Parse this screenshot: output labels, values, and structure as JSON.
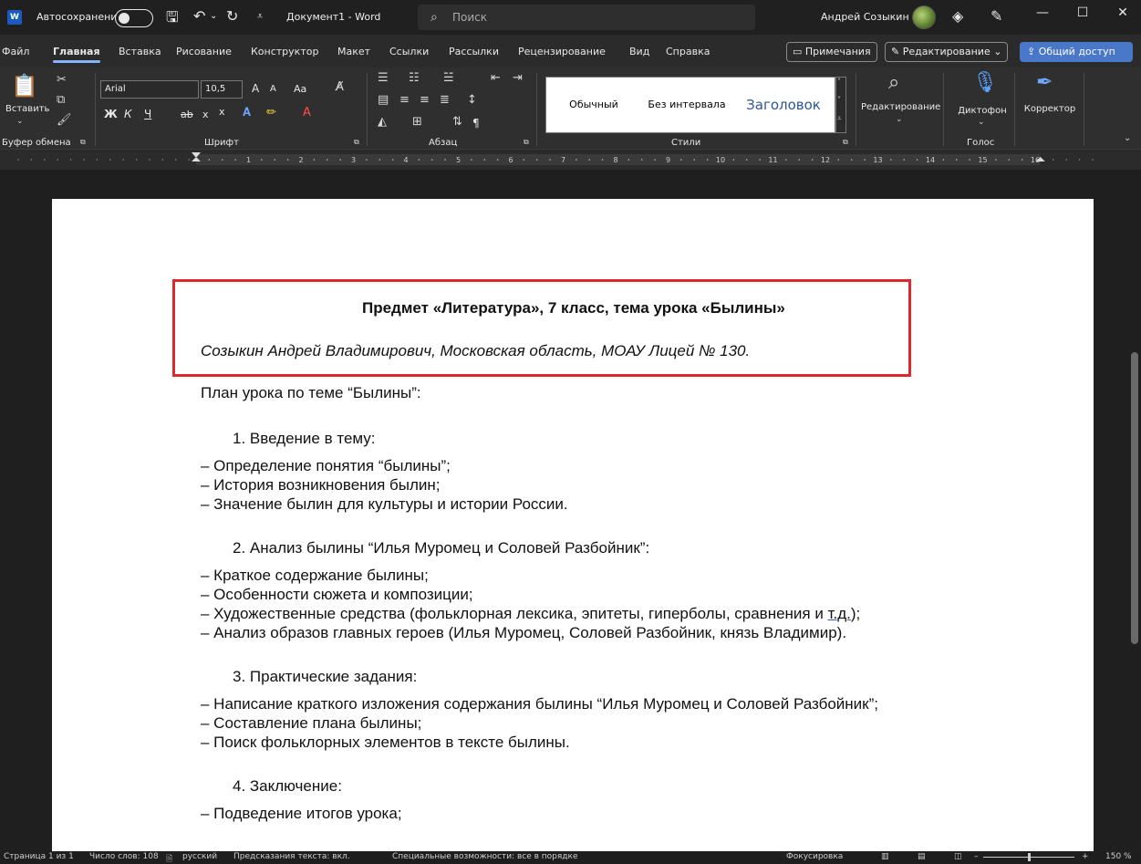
{
  "titlebar": {
    "app_icon_letter": "W",
    "autosave_label": "Автосохранение",
    "autosave_state": "Откл.",
    "doc_title": "Документ1 - Word",
    "search_placeholder": "Поиск",
    "user_name": "Андрей Созыкин",
    "icons": [
      "save-icon",
      "undo-icon",
      "redo-icon",
      "customize-icon",
      "diamond-icon",
      "pen-icon"
    ],
    "minimize": "—",
    "maximize": "☐",
    "close": "✕"
  },
  "tabs": {
    "file": "Файл",
    "home": "Главная",
    "insert": "Вставка",
    "draw": "Рисование",
    "design": "Конструктор",
    "layout": "Макет",
    "references": "Ссылки",
    "mailings": "Рассылки",
    "review": "Рецензирование",
    "view": "Вид",
    "help": "Справка",
    "comments": "Примечания",
    "editing": "Редактирование",
    "share": "Общий доступ"
  },
  "ribbon": {
    "clipboard": {
      "paste": "Вставить",
      "label": "Буфер обмена"
    },
    "font": {
      "name": "Arial",
      "size": "10,5",
      "case": "Aa",
      "bold": "Ж",
      "italic": "К",
      "underline": "Ч",
      "strike": "ab",
      "sub": "x",
      "sup": "x",
      "grow": "A",
      "shrink": "A",
      "label": "Шрифт"
    },
    "paragraph": {
      "label": "Абзац",
      "pilcrow": "¶"
    },
    "styles": {
      "items": [
        "Обычный",
        "Без интервала",
        "Заголовок"
      ],
      "label": "Стили"
    },
    "editing": {
      "label": "Редактирование"
    },
    "voice": {
      "dictate": "Диктофон",
      "label": "Голос"
    },
    "editor": {
      "label": "Корректор"
    }
  },
  "ruler": {
    "numbers": [
      "1",
      "2",
      "3",
      "4",
      "5",
      "6",
      "7",
      "8",
      "9",
      "10",
      "11",
      "12",
      "13",
      "14",
      "15",
      "16"
    ]
  },
  "document": {
    "title": "Предмет «Литература», 7 класс, тема урока «Былины»",
    "author": "Созыкин Андрей Владимирович, Московская область, МОАУ Лицей № 130.",
    "plan_intro": "План урока по теме “Былины”:",
    "s1_heading": "1.  Введение в тему:",
    "s1_items": [
      "– Определение понятия “былины”;",
      "– История возникновения былин;",
      "– Значение былин для культуры и истории России."
    ],
    "s2_heading": "2.  Анализ былины “Илья Муромец и Соловей Разбойник”:",
    "s2_items": [
      "– Краткое содержание былины;",
      "– Особенности сюжета и композиции;",
      "– Художественные средства (фольклорная лексика, эпитеты, гиперболы, сравнения и ",
      "– Анализ образов главных героев (Илья Муромец, Соловей Разбойник, князь Владимир)."
    ],
    "s2_abbr": "т.д.",
    "s2_tail": ");",
    "s3_heading": "3.  Практические задания:",
    "s3_items": [
      "– Написание краткого изложения содержания былины “Илья Муромец и Соловей Разбойник”;",
      "– Составление плана былины;",
      "– Поиск фольклорных элементов в тексте былины."
    ],
    "s4_heading": "4.  Заключение:",
    "s4_items": [
      "– Подведение итогов урока;"
    ]
  },
  "statusbar": {
    "page": "Страница 1 из 1",
    "words": "Число слов: 108",
    "language": "русский",
    "predictions": "Предсказания текста: вкл.",
    "accessibility": "Специальные возможности: все в порядке",
    "focus": "Фокусировка",
    "zoom": "150 %",
    "zoom_minus": "–",
    "zoom_plus": "+"
  },
  "colors": {
    "highlight_border": "#e0272e",
    "share_button": "#4a78c8",
    "heading_style": "#2f5496",
    "active_tab_underline": "#85b4ff"
  }
}
